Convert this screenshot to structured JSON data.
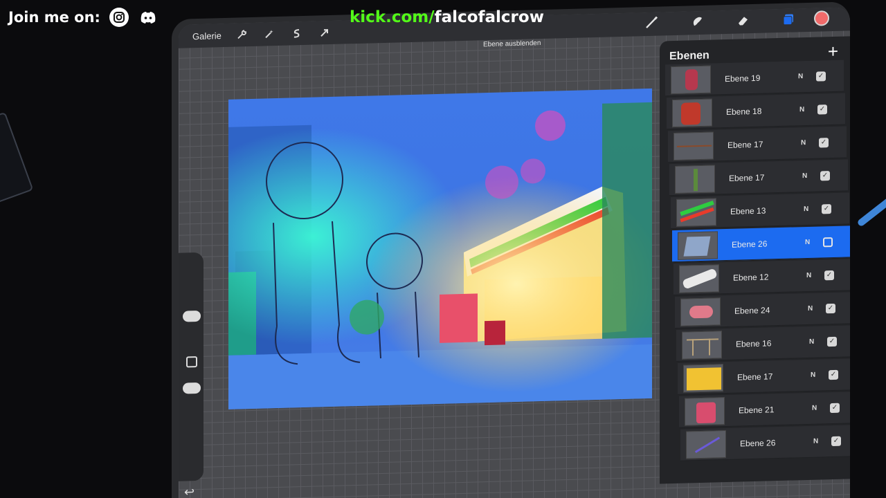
{
  "overlay": {
    "join_text": "Join me on:",
    "social_icons": [
      "instagram-icon",
      "discord-icon"
    ],
    "url_domain": "kick.com/",
    "url_user": "falcofalcrow",
    "colors": {
      "kick_green": "#53fc18"
    }
  },
  "topbar": {
    "gallery_label": "Galerie",
    "tools": [
      "wrench-icon",
      "magic-wand-icon",
      "selection-icon",
      "transform-arrow-icon"
    ],
    "right_tools": [
      "brush-icon",
      "smudge-icon",
      "eraser-icon",
      "layers-icon",
      "color-icon"
    ],
    "notice": "Ebene ausblenden"
  },
  "layers": {
    "title": "Ebenen",
    "add_icon": "plus-icon",
    "items": [
      {
        "name": "Ebene 19",
        "blend": "N",
        "visible": true,
        "selected": false
      },
      {
        "name": "Ebene 18",
        "blend": "N",
        "visible": true,
        "selected": false
      },
      {
        "name": "Ebene 17",
        "blend": "N",
        "visible": true,
        "selected": false
      },
      {
        "name": "Ebene 17",
        "blend": "N",
        "visible": true,
        "selected": false
      },
      {
        "name": "Ebene 13",
        "blend": "N",
        "visible": true,
        "selected": false
      },
      {
        "name": "Ebene 26",
        "blend": "N",
        "visible": false,
        "selected": true
      },
      {
        "name": "Ebene 12",
        "blend": "N",
        "visible": true,
        "selected": false
      },
      {
        "name": "Ebene 24",
        "blend": "N",
        "visible": true,
        "selected": false
      },
      {
        "name": "Ebene 16",
        "blend": "N",
        "visible": true,
        "selected": false
      },
      {
        "name": "Ebene 17",
        "blend": "N",
        "visible": true,
        "selected": false
      },
      {
        "name": "Ebene 21",
        "blend": "N",
        "visible": true,
        "selected": false
      },
      {
        "name": "Ebene 26",
        "blend": "N",
        "visible": true,
        "selected": false
      }
    ]
  }
}
